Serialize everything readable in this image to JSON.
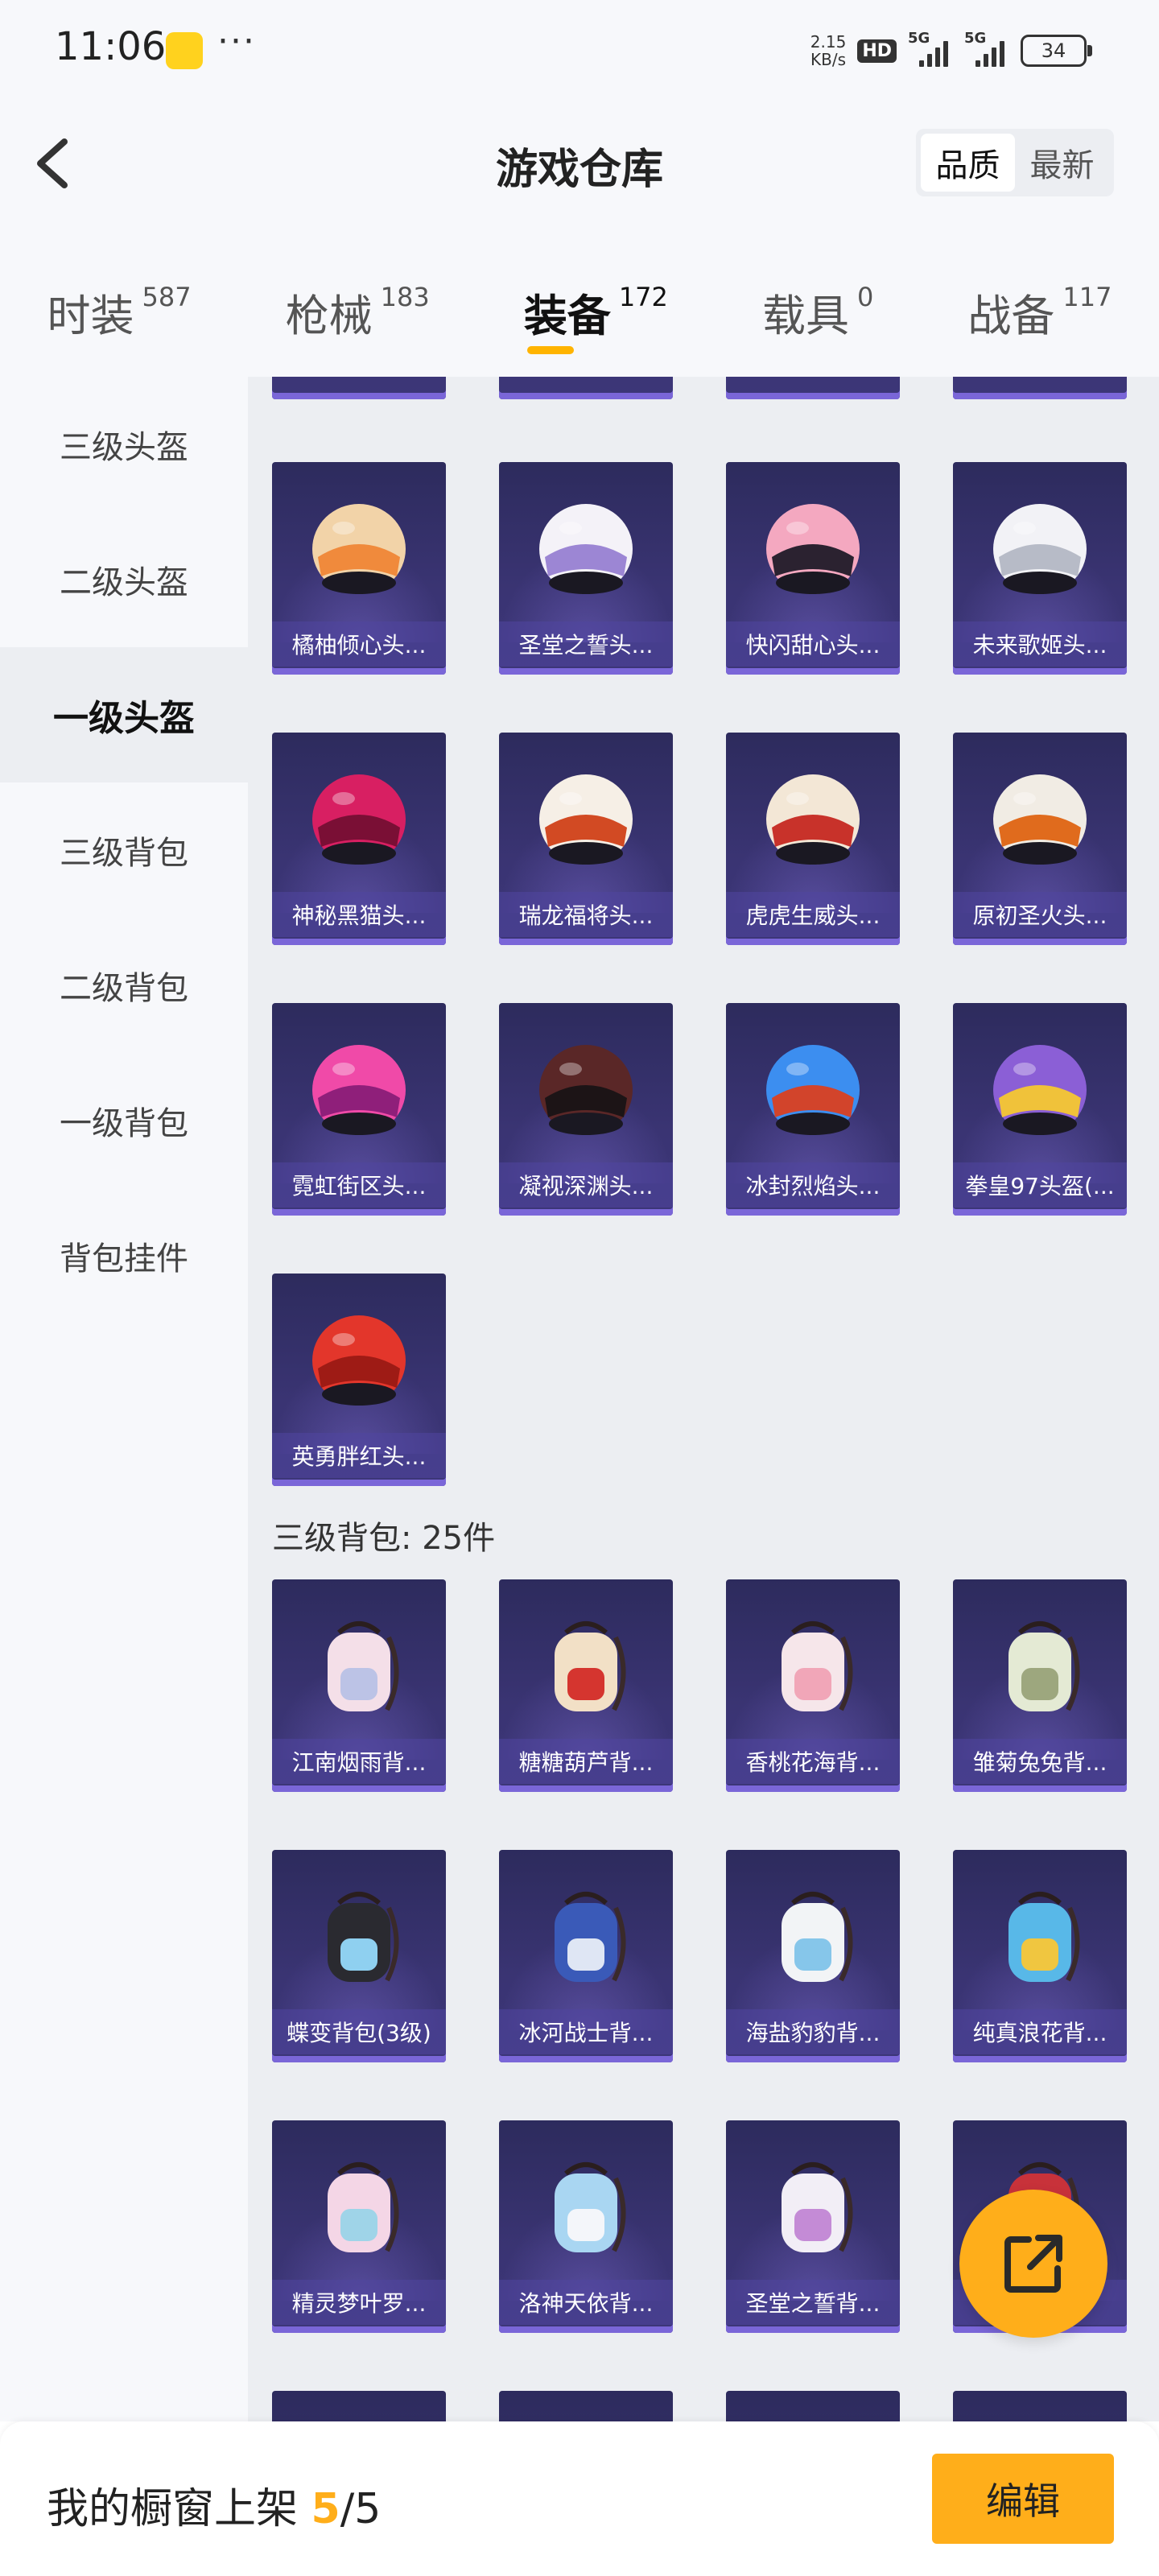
{
  "status_bar": {
    "time": "11:06",
    "dots": "···",
    "net_speed_value": "2.15",
    "net_speed_unit": "KB/s",
    "hd_label": "HD",
    "signal1_label": "5G",
    "signal2_label": "5G",
    "battery": "34"
  },
  "header": {
    "title": "游戏仓库",
    "sort_options": [
      "品质",
      "最新"
    ],
    "active_sort": "品质"
  },
  "tabs": [
    {
      "label": "时装",
      "count": "587"
    },
    {
      "label": "枪械",
      "count": "183"
    },
    {
      "label": "装备",
      "count": "172"
    },
    {
      "label": "载具",
      "count": "0"
    },
    {
      "label": "战备",
      "count": "117"
    }
  ],
  "active_tab": "装备",
  "sidebar": {
    "items": [
      "三级头盔",
      "二级头盔",
      "一级头盔",
      "三级背包",
      "二级背包",
      "一级背包",
      "背包挂件"
    ],
    "active": "一级头盔"
  },
  "helmets": [
    {
      "name": "橘柚倾心头...",
      "colors": [
        "#f2d3a8",
        "#f08a3c"
      ]
    },
    {
      "name": "圣堂之誓头...",
      "colors": [
        "#f4f2f8",
        "#9c86d4"
      ]
    },
    {
      "name": "快闪甜心头...",
      "colors": [
        "#f4a8c0",
        "#2b2230"
      ]
    },
    {
      "name": "未来歌姬头...",
      "colors": [
        "#f2f2f6",
        "#b7bbc7"
      ]
    },
    {
      "name": "神秘黑猫头...",
      "colors": [
        "#d81f62",
        "#7a0f35"
      ]
    },
    {
      "name": "瑞龙福将头...",
      "colors": [
        "#f6efe6",
        "#d24a23"
      ]
    },
    {
      "name": "虎虎生威头...",
      "colors": [
        "#f3e7d6",
        "#c8322a"
      ]
    },
    {
      "name": "原初圣火头...",
      "colors": [
        "#f1ece4",
        "#e06b1d"
      ]
    },
    {
      "name": "霓虹街区头...",
      "colors": [
        "#f04aa8",
        "#8f1f7a"
      ]
    },
    {
      "name": "凝视深渊头...",
      "colors": [
        "#5a2727",
        "#1c1416"
      ]
    },
    {
      "name": "冰封烈焰头...",
      "colors": [
        "#3c8ef0",
        "#d2442b"
      ]
    },
    {
      "name": "拳皇97头盔(...",
      "colors": [
        "#8b5fd6",
        "#f0c23a"
      ]
    },
    {
      "name": "英勇胖红头...",
      "colors": [
        "#e3362b",
        "#9e1b15"
      ]
    }
  ],
  "backpack_section_title": "三级背包: 25件",
  "backpacks": [
    {
      "name": "江南烟雨背...",
      "colors": [
        "#f4dfe8",
        "#bcc3e6"
      ]
    },
    {
      "name": "糖糖葫芦背...",
      "colors": [
        "#f2e0c6",
        "#d5352f"
      ]
    },
    {
      "name": "香桃花海背...",
      "colors": [
        "#f6e6ea",
        "#f1a6b8"
      ]
    },
    {
      "name": "雏菊兔兔背...",
      "colors": [
        "#e4ead4",
        "#9da77e"
      ]
    },
    {
      "name": "蝶变背包(3级)",
      "colors": [
        "#2a2a30",
        "#8fd0f0"
      ]
    },
    {
      "name": "冰河战士背...",
      "colors": [
        "#3a5ab8",
        "#dfe6f4"
      ]
    },
    {
      "name": "海盐豹豹背...",
      "colors": [
        "#f2f4f6",
        "#86c6ea"
      ]
    },
    {
      "name": "纯真浪花背...",
      "colors": [
        "#58b8e8",
        "#f0c640"
      ]
    },
    {
      "name": "精灵梦叶罗...",
      "colors": [
        "#f4d6e6",
        "#9fd4e8"
      ]
    },
    {
      "name": "洛神天依背...",
      "colors": [
        "#a9d6f2",
        "#f4f6fa"
      ]
    },
    {
      "name": "圣堂之誓背...",
      "colors": [
        "#f2eef6",
        "#c48bd6"
      ]
    },
    {
      "name": "",
      "colors": [
        "#c8323a",
        "#6a1a22"
      ]
    }
  ],
  "bottom": {
    "prefix": "我的橱窗上架 ",
    "current": "5",
    "total": "/5",
    "edit_label": "编辑"
  }
}
